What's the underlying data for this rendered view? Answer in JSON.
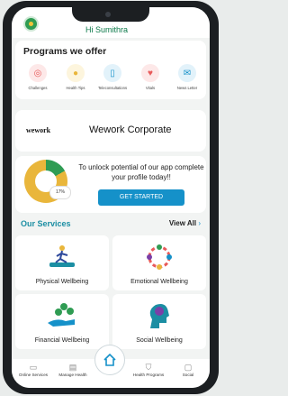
{
  "header": {
    "greeting": "Hi Sumithra"
  },
  "programs": {
    "title": "Programs we offer",
    "items": [
      {
        "label": "Challenges",
        "icon": "target-icon",
        "color": "#e85a5a"
      },
      {
        "label": "Health Tips",
        "icon": "bulb-icon",
        "color": "#f1c43a"
      },
      {
        "label": "Teleconsultations",
        "icon": "phone-icon",
        "color": "#1591c9"
      },
      {
        "label": "Vitals",
        "icon": "heart-monitor-icon",
        "color": "#e85a5a"
      },
      {
        "label": "News Letter",
        "icon": "mail-icon",
        "color": "#1591c9"
      }
    ]
  },
  "corporate": {
    "logo": "wework",
    "name": "Wework Corporate"
  },
  "profile": {
    "percent_label": "17%",
    "completion": 0.17,
    "message": "To unlock potential of our app complete your profile today!!",
    "cta": "GET STARTED"
  },
  "services": {
    "title": "Our Services",
    "view_all": "View All",
    "items": [
      {
        "label": "Physical Wellbeing",
        "icon": "running-icon"
      },
      {
        "label": "Emotional Wellbeing",
        "icon": "people-circle-icon"
      },
      {
        "label": "Financial Wellbeing",
        "icon": "coins-hand-icon"
      },
      {
        "label": "Social Wellbeing",
        "icon": "head-brain-icon"
      }
    ]
  },
  "bottom_nav": {
    "items": [
      {
        "label": "Online Services",
        "icon": "laptop-icon"
      },
      {
        "label": "Manage Health",
        "icon": "clipboard-icon"
      },
      {
        "label": "Home",
        "icon": "home-icon"
      },
      {
        "label": "Health Programs",
        "icon": "shield-icon"
      },
      {
        "label": "Social",
        "icon": "chat-icon"
      }
    ]
  },
  "colors": {
    "brand_green": "#0d7a4a",
    "accent_blue": "#1591c9",
    "teal": "#1b8ea3"
  }
}
